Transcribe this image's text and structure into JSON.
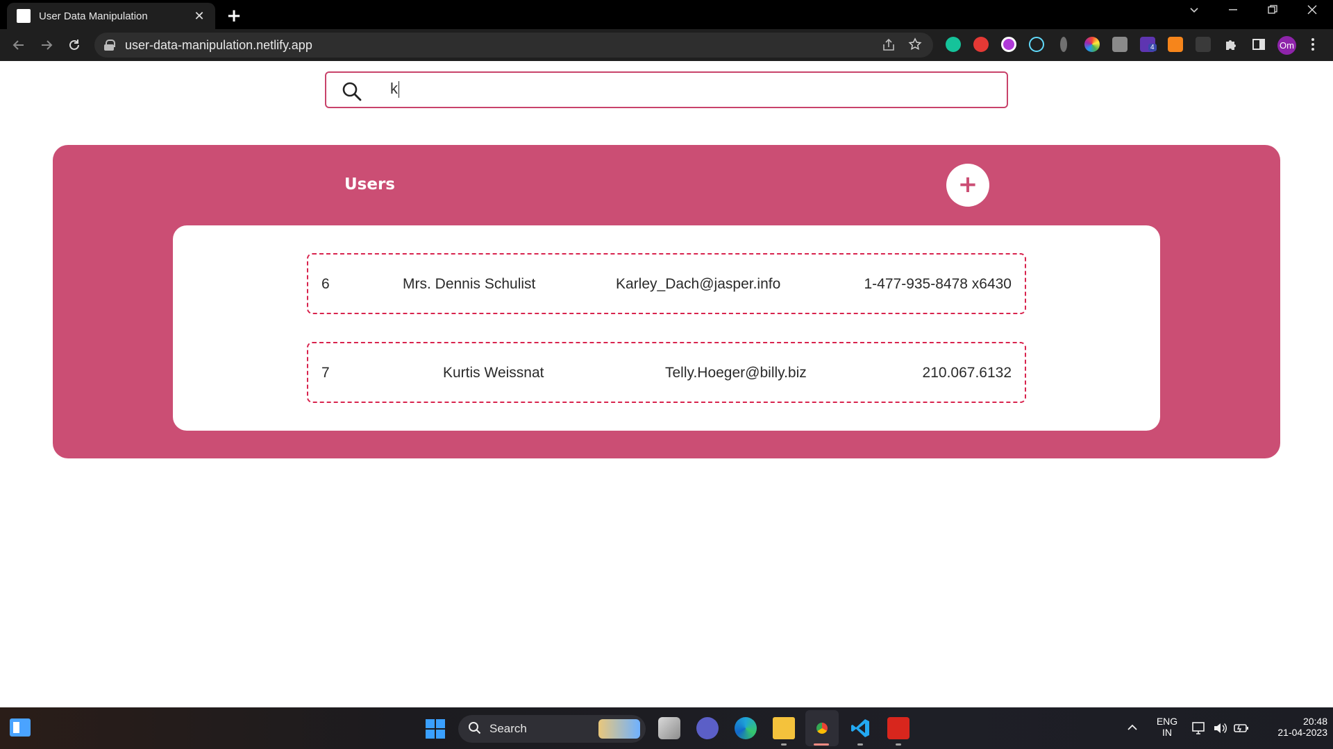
{
  "browser": {
    "tab_title": "User Data Manipulation",
    "tab_close": "✕",
    "new_tab": "+",
    "url": "user-data-manipulation.netlify.app",
    "profile_initials": "Om",
    "extension_badge": "4"
  },
  "search": {
    "value": "k"
  },
  "panel": {
    "title": "Users",
    "add_button": "+",
    "accent_color": "#cb4e74"
  },
  "users": [
    {
      "id": "6",
      "name": "Mrs. Dennis Schulist",
      "email": "Karley_Dach@jasper.info",
      "phone": "1-477-935-8478 x6430"
    },
    {
      "id": "7",
      "name": "Kurtis Weissnat",
      "email": "Telly.Hoeger@billy.biz",
      "phone": "210.067.6132"
    }
  ],
  "taskbar": {
    "search_label": "Search",
    "language_line1": "ENG",
    "language_line2": "IN",
    "time": "20:48",
    "date": "21-04-2023"
  }
}
